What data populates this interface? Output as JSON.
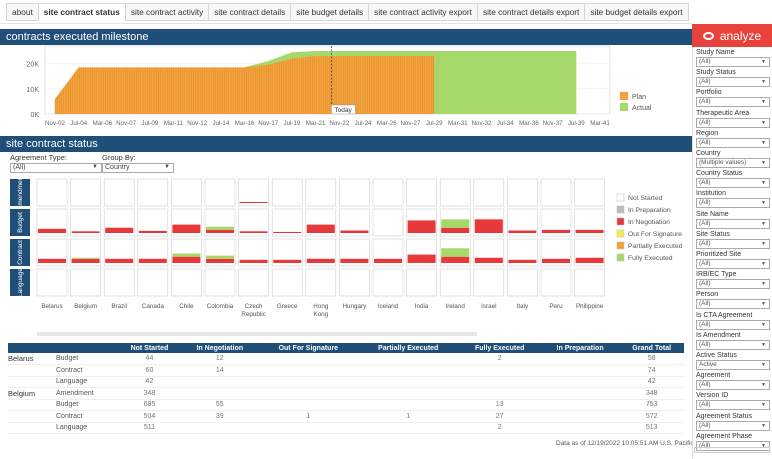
{
  "tabs": [
    "about",
    "site contract status",
    "site contract activity",
    "site contract details",
    "site budget details",
    "site contract activity export",
    "site contract details export",
    "site budget details export"
  ],
  "active_tab": "site contract status",
  "milestone": {
    "title": "contracts executed milestone",
    "y_ticks": [
      "20K",
      "10K",
      "0K"
    ],
    "x_ticks": [
      "Nov-02",
      "Jul-04",
      "Mar-06",
      "Nov-07",
      "Jul-09",
      "Mar-11",
      "Nov-12",
      "Jul-14",
      "Mar-16",
      "Nov-17",
      "Jul-19",
      "Mar-21",
      "Nov-22",
      "Jul-24",
      "Mar-26",
      "Nov-27",
      "Jul-29",
      "Mar-31",
      "Nov-32",
      "Jul-34",
      "Mar-36",
      "Nov-37",
      "Jul-39",
      "Mar-41"
    ],
    "today_label": "Today",
    "legend": [
      {
        "label": "Plan",
        "color": "#f2a13b"
      },
      {
        "label": "Actual",
        "color": "#a6d96a"
      }
    ]
  },
  "status": {
    "title": "site contract status",
    "agreement_type_label": "Agreement Type:",
    "agreement_type_value": "(All)",
    "group_by_label": "Group By:",
    "group_by_value": "Country",
    "rows": [
      "Amendment",
      "Budget",
      "Contract",
      "Language"
    ],
    "countries": [
      "Belarus",
      "Belgium",
      "Brazil",
      "Canada",
      "Chile",
      "Colombia",
      "Czech Republic",
      "Greece",
      "Hong Kong",
      "Hungary",
      "Iceland",
      "India",
      "Ireland",
      "Israel",
      "Italy",
      "Peru",
      "Philippine"
    ],
    "legend": [
      {
        "label": "Not Started",
        "color": "#ffffff"
      },
      {
        "label": "In Preparation",
        "color": "#bdbdbd"
      },
      {
        "label": "In Negotiation",
        "color": "#e8393a"
      },
      {
        "label": "Out For Signature",
        "color": "#f7ec4a"
      },
      {
        "label": "Partially Executed",
        "color": "#f2a13b"
      },
      {
        "label": "Fully Executed",
        "color": "#a6d96a"
      }
    ]
  },
  "table": {
    "headers": [
      "",
      "",
      "Not Started",
      "In Negotiation",
      "Out For Signature",
      "Partially Executed",
      "Fully Executed",
      "In Preparation",
      "Grand Total"
    ],
    "rows": [
      [
        "Belarus",
        "Budget",
        "44",
        "12",
        "",
        "",
        "2",
        "",
        "58"
      ],
      [
        "",
        "Contract",
        "60",
        "14",
        "",
        "",
        "",
        "",
        "74"
      ],
      [
        "",
        "Language",
        "42",
        "",
        "",
        "",
        "",
        "",
        "42"
      ],
      [
        "Belgium",
        "Amendment",
        "348",
        "",
        "",
        "",
        "",
        "",
        "348"
      ],
      [
        "",
        "Budget",
        "685",
        "55",
        "",
        "",
        "13",
        "",
        "753"
      ],
      [
        "",
        "Contract",
        "504",
        "39",
        "1",
        "1",
        "27",
        "",
        "572"
      ],
      [
        "",
        "Language",
        "511",
        "",
        "",
        "",
        "2",
        "",
        "513"
      ]
    ]
  },
  "data_stamp": "Data as of 12/19/2022 10:05:51 AM U.S. Pacific",
  "brand": "analyze",
  "sidebar_filters": [
    {
      "label": "Study Name",
      "value": "(All)"
    },
    {
      "label": "Study Status",
      "value": "(All)"
    },
    {
      "label": "Portfolio",
      "value": "(All)"
    },
    {
      "label": "Therapeutic Area",
      "value": "(All)"
    },
    {
      "label": "Region",
      "value": "(All)"
    },
    {
      "label": "Country",
      "value": "(Multiple values)"
    },
    {
      "label": "Country Status",
      "value": "(All)"
    },
    {
      "label": "Institution",
      "value": "(All)"
    },
    {
      "label": "Site Name",
      "value": "(All)"
    },
    {
      "label": "Site Status",
      "value": "(All)"
    },
    {
      "label": "Prioritized Site",
      "value": "(All)"
    },
    {
      "label": "IRB/EC Type",
      "value": "(All)"
    },
    {
      "label": "Person",
      "value": "(All)"
    },
    {
      "label": "Is CTA Agreement",
      "value": "(All)"
    },
    {
      "label": "Is Amendment",
      "value": "(All)"
    },
    {
      "label": "Active Status",
      "value": "Active"
    },
    {
      "label": "Agreement",
      "value": "(All)"
    },
    {
      "label": "Version ID",
      "value": "(All)"
    },
    {
      "label": "Agreement Status",
      "value": "(All)"
    },
    {
      "label": "Agreement Phase",
      "value": "(All)"
    }
  ],
  "chart_data": [
    {
      "type": "area",
      "title": "contracts executed milestone",
      "x": [
        "Nov-02",
        "Jul-04",
        "Mar-06",
        "Nov-07",
        "Jul-09",
        "Mar-11",
        "Nov-12",
        "Jul-14",
        "Mar-16",
        "Nov-17",
        "Jul-19",
        "Mar-21",
        "Nov-22",
        "Jul-24",
        "Mar-26",
        "Nov-27",
        "Jul-29",
        "Mar-31",
        "Nov-32",
        "Jul-34",
        "Mar-36",
        "Nov-37",
        "Jul-39",
        "Mar-41"
      ],
      "series": [
        {
          "name": "Plan",
          "values": [
            6000,
            18500,
            18500,
            18500,
            18500,
            18500,
            18500,
            18500,
            18500,
            19500,
            22000,
            23000,
            23000,
            23000,
            23000,
            23000,
            23000,
            null,
            null,
            null,
            null,
            null,
            null,
            null
          ]
        },
        {
          "name": "Actual",
          "values": [
            null,
            null,
            null,
            null,
            null,
            null,
            null,
            null,
            18600,
            21000,
            24500,
            25000,
            25000,
            25000,
            25000,
            25000,
            25000,
            25000,
            25000,
            25000,
            25000,
            25000,
            25000,
            null
          ]
        }
      ],
      "ylim": [
        0,
        27000
      ]
    },
    {
      "type": "bar",
      "title": "site contract status",
      "categories": [
        "Belarus",
        "Belgium",
        "Brazil",
        "Canada",
        "Chile",
        "Colombia",
        "Czech Republic",
        "Greece",
        "Hong Kong",
        "Hungary",
        "Iceland",
        "India",
        "Ireland",
        "Israel",
        "Italy",
        "Peru",
        "Philippine"
      ],
      "series": [
        {
          "name": "Amendment / In Negotiation",
          "values": [
            0,
            0,
            0,
            0,
            0,
            0,
            0.05,
            0,
            0,
            0,
            0,
            0,
            0,
            0,
            0,
            0,
            0
          ]
        },
        {
          "name": "Budget / In Negotiation",
          "values": [
            0.2,
            0.08,
            0.25,
            0.1,
            0.4,
            0.15,
            0.08,
            0.05,
            0.4,
            0.12,
            0,
            0.6,
            0.25,
            0.65,
            0.12,
            0.15,
            0.15
          ]
        },
        {
          "name": "Budget / Fully Executed",
          "values": [
            0,
            0,
            0,
            0,
            0,
            0.15,
            0,
            0,
            0,
            0,
            0,
            0,
            0.4,
            0,
            0,
            0,
            0
          ]
        },
        {
          "name": "Contract / In Negotiation",
          "values": [
            0.2,
            0.2,
            0.2,
            0.2,
            0.3,
            0.2,
            0.15,
            0.15,
            0.2,
            0.2,
            0.2,
            0.4,
            0.3,
            0.25,
            0.15,
            0.2,
            0.25
          ]
        },
        {
          "name": "Contract / Fully Executed",
          "values": [
            0,
            0.05,
            0,
            0,
            0.15,
            0.15,
            0,
            0,
            0,
            0,
            0,
            0,
            0.4,
            0,
            0,
            0,
            0
          ]
        }
      ]
    }
  ]
}
